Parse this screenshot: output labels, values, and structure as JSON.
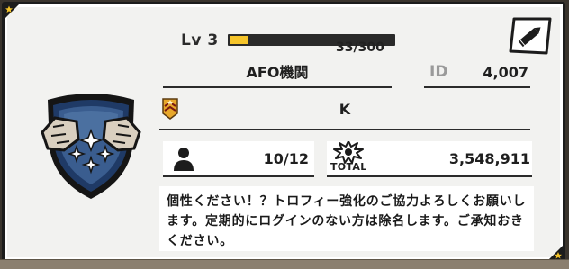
{
  "profile": {
    "level_label": "Lv 3",
    "xp_text": "33/300",
    "xp_progress": 0.11,
    "name": "AFO機関",
    "id_label": "ID",
    "id_value": "4,007",
    "rank_text": "K",
    "members": "10/12",
    "total_label": "TOTAL",
    "total_value": "3,548,911",
    "description": "個性ください！？トロフィー強化のご協力よろしくお願いします。定期的にログインのない方は除名します。ご承知おきください。"
  },
  "colors": {
    "xp_fill": "#f5c42a",
    "emblem_blue": "#1f3a66",
    "rank_badge": "#e8a72a"
  },
  "icons": [
    "edit-pencil-icon",
    "member-icon",
    "trophy-burst-icon",
    "rank-badge-icon",
    "corner-star-icon"
  ]
}
